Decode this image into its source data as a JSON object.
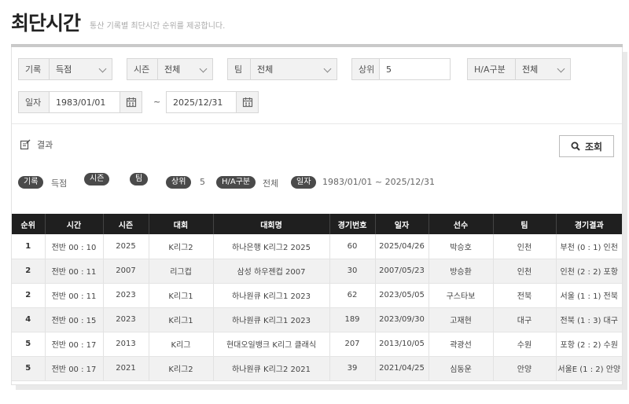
{
  "header": {
    "title": "최단시간",
    "description": "통산 기록별 최단시간 순위를 제공합니다."
  },
  "filters": {
    "record": {
      "label": "기록",
      "value": "득점"
    },
    "season": {
      "label": "시즌",
      "value": "전체"
    },
    "team": {
      "label": "팀",
      "value": "전체"
    },
    "rank": {
      "label": "상위",
      "value": "5"
    },
    "ha": {
      "label": "H/A구분",
      "value": "전체"
    },
    "date": {
      "label": "일자",
      "from": "1983/01/01",
      "tilde": "~",
      "to": "2025/12/31"
    }
  },
  "result": {
    "title": "결과",
    "search_label": "조회"
  },
  "chips": {
    "record_label": "기록",
    "record_value": "득점",
    "season_label": "시즌",
    "team_label": "팀",
    "rank_label": "상위",
    "rank_value": "5",
    "ha_label": "H/A구분",
    "ha_value": "전체",
    "date_label": "일자",
    "date_value": "1983/01/01 ~ 2025/12/31"
  },
  "table": {
    "headers": [
      "순위",
      "시간",
      "시즌",
      "대회",
      "대회명",
      "경기번호",
      "일자",
      "선수",
      "팀",
      "경기결과"
    ],
    "rows": [
      [
        "1",
        "전반   00 : 10",
        "2025",
        "K리그2",
        "하나은행 K리그2 2025",
        "60",
        "2025/04/26",
        "박승호",
        "인천",
        "부천 (0 : 1) 인천"
      ],
      [
        "2",
        "전반   00 : 11",
        "2007",
        "리그컵",
        "삼성 하우젠컵 2007",
        "30",
        "2007/05/23",
        "방승환",
        "인천",
        "인천 (2 : 2) 포항"
      ],
      [
        "2",
        "전반   00 : 11",
        "2023",
        "K리그1",
        "하나원큐 K리그1 2023",
        "62",
        "2023/05/05",
        "구스타보",
        "전북",
        "서울 (1 : 1) 전북"
      ],
      [
        "4",
        "전반   00 : 15",
        "2023",
        "K리그1",
        "하나원큐 K리그1 2023",
        "189",
        "2023/09/30",
        "고재현",
        "대구",
        "전북 (1 : 3) 대구"
      ],
      [
        "5",
        "전반   00 : 17",
        "2013",
        "K리그",
        "현대오일뱅크 K리그 클래식",
        "207",
        "2013/10/05",
        "곽광선",
        "수원",
        "포항 (2 : 2) 수원"
      ],
      [
        "5",
        "전반   00 : 17",
        "2021",
        "K리그2",
        "하나원큐 K리그2 2021",
        "39",
        "2021/04/25",
        "심동운",
        "안양",
        "서울E (1 : 2) 안양"
      ]
    ]
  }
}
